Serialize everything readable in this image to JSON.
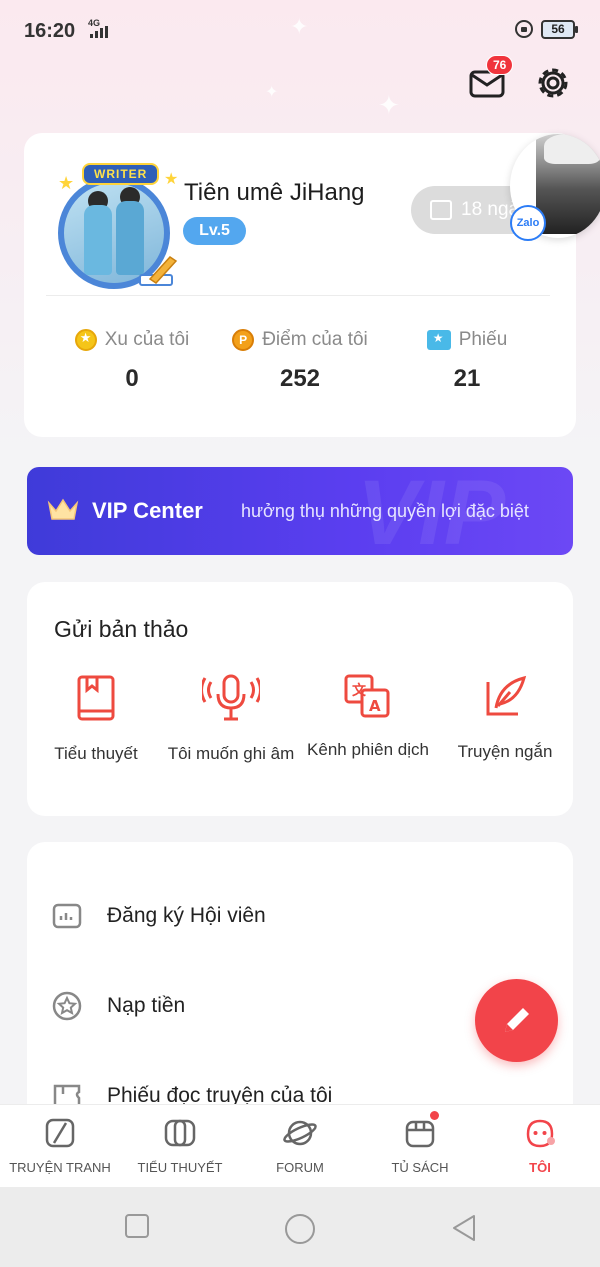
{
  "status_bar": {
    "time": "16:20",
    "network": "4G",
    "battery": "56"
  },
  "header": {
    "mail_badge": "76"
  },
  "profile": {
    "avatar_badge": "WRITER",
    "username": "Tiên umê JiHang",
    "level": "Lv.5",
    "checkin_text": "18 ngày",
    "zalo_label": "Zalo",
    "stats": [
      {
        "label": "Xu của tôi",
        "value": "0"
      },
      {
        "label": "Điểm của tôi",
        "value": "252"
      },
      {
        "label": "Phiếu",
        "value": "21"
      }
    ]
  },
  "vip": {
    "title": "VIP Center",
    "subtitle": "hưởng thụ những quyền lợi đặc biệt",
    "watermark": "VIP"
  },
  "submit": {
    "title": "Gửi bản thảo",
    "items": [
      {
        "label": "Tiểu thuyết",
        "icon": "book-icon"
      },
      {
        "label": "Tôi muốn ghi âm",
        "icon": "microphone-icon"
      },
      {
        "label": "Kênh phiên dịch",
        "icon": "translate-icon"
      },
      {
        "label": "Truyện ngắn",
        "icon": "quill-icon"
      }
    ]
  },
  "menu": {
    "items": [
      {
        "label": "Đăng ký Hội viên",
        "icon": "membership-icon"
      },
      {
        "label": "Nạp tiền",
        "icon": "star-circle-icon"
      },
      {
        "label": "Phiếu đọc truyện của tôi",
        "icon": "ticket-icon"
      }
    ]
  },
  "bottom_nav": {
    "items": [
      {
        "label": "TRUYỆN TRANH",
        "icon": "comic-icon"
      },
      {
        "label": "TIỂU THUYẾT",
        "icon": "novel-icon"
      },
      {
        "label": "FORUM",
        "icon": "planet-icon"
      },
      {
        "label": "TỦ SÁCH",
        "icon": "bookshelf-icon"
      },
      {
        "label": "TÔI",
        "icon": "me-icon"
      }
    ],
    "active": "TÔI"
  },
  "colors": {
    "accent": "#f2444a",
    "vip": "#4a3de6",
    "level": "#53a7ef"
  }
}
